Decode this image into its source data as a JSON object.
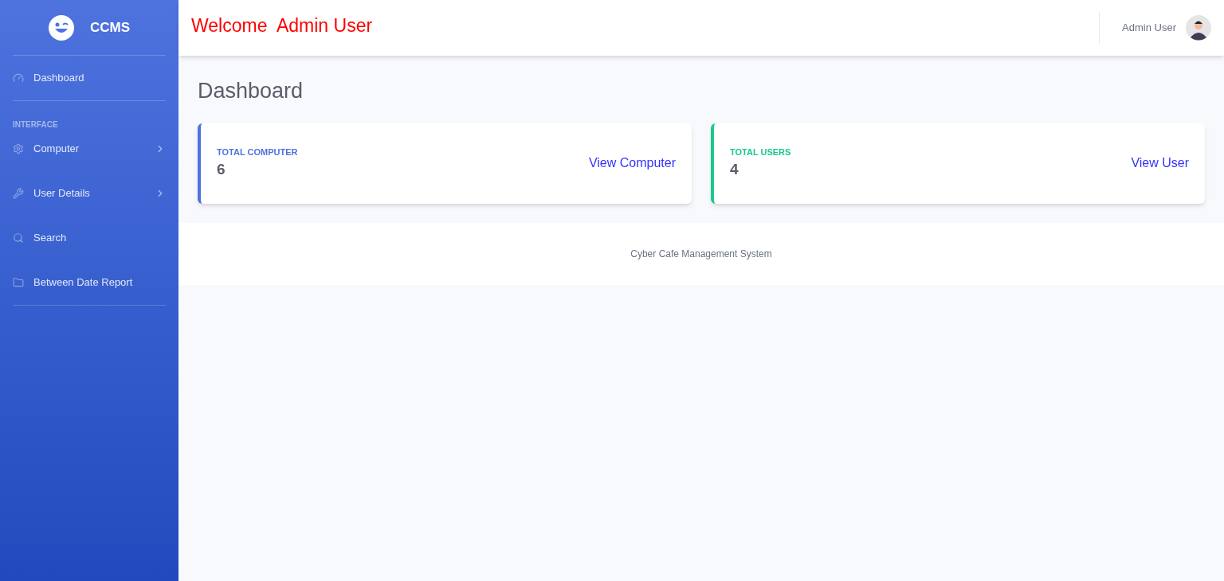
{
  "brand": {
    "name": "CCMS"
  },
  "sidebar": {
    "items": [
      {
        "kind": "dashboard",
        "label": "Dashboard",
        "expandable": false
      },
      {
        "kind": "heading",
        "label": "INTERFACE"
      },
      {
        "kind": "computer",
        "label": "Computer",
        "expandable": true
      },
      {
        "kind": "users",
        "label": "User Details",
        "expandable": true
      },
      {
        "kind": "search",
        "label": "Search",
        "expandable": false
      },
      {
        "kind": "report",
        "label": "Between Date Report",
        "expandable": false
      }
    ]
  },
  "topbar": {
    "welcome": "Welcome  Admin User",
    "user_name": "Admin User"
  },
  "page_title": "Dashboard",
  "cards": [
    {
      "label": "TOTAL COMPUTER",
      "value": "6",
      "link": "View Computer",
      "color": "#4e73df"
    },
    {
      "label": "TOTAL USERS",
      "value": "4",
      "link": "View User",
      "color": "#1cc88a"
    }
  ],
  "footer": "Cyber Cafe Management System"
}
